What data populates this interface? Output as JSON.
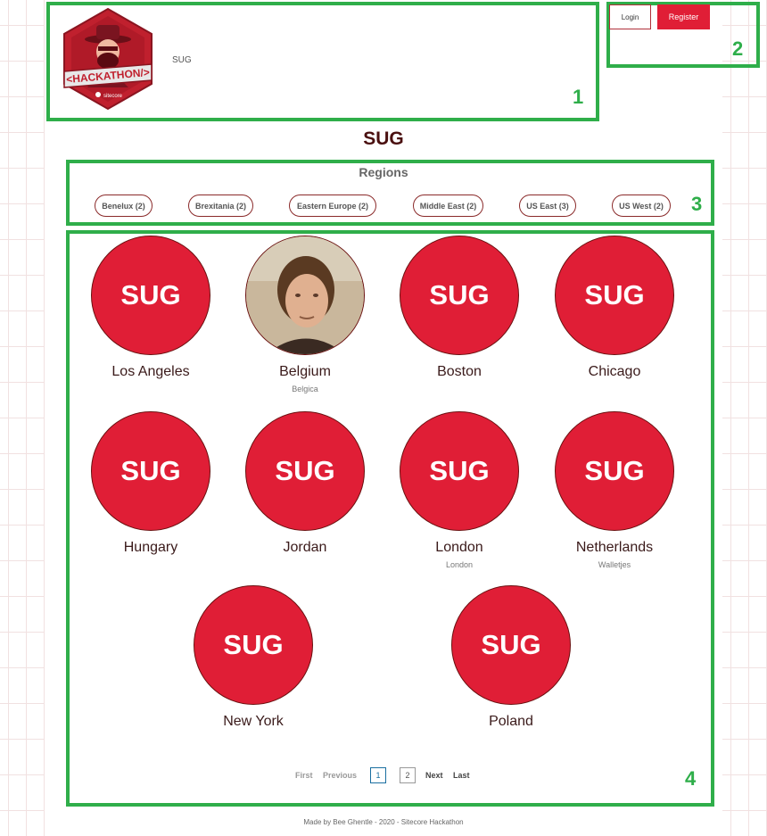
{
  "header": {
    "site_name": "SUG",
    "logo_text": "<HACKATHON/>",
    "logo_sub": "sitecore"
  },
  "auth": {
    "login_label": "Login",
    "register_label": "Register"
  },
  "page": {
    "title": "SUG"
  },
  "regions": {
    "heading": "Regions",
    "items": [
      {
        "label": "Benelux (2)"
      },
      {
        "label": "Brexitania (2)"
      },
      {
        "label": "Eastern Europe (2)"
      },
      {
        "label": "Middle East (2)"
      },
      {
        "label": "US East (3)"
      },
      {
        "label": "US West (2)"
      }
    ]
  },
  "groups": [
    {
      "name": "Los Angeles",
      "sub": "",
      "badge": "SUG"
    },
    {
      "name": "Belgium",
      "sub": "Belgica",
      "badge": ""
    },
    {
      "name": "Boston",
      "sub": "",
      "badge": "SUG"
    },
    {
      "name": "Chicago",
      "sub": "",
      "badge": "SUG"
    },
    {
      "name": "Hungary",
      "sub": "",
      "badge": "SUG"
    },
    {
      "name": "Jordan",
      "sub": "",
      "badge": "SUG"
    },
    {
      "name": "London",
      "sub": "London",
      "badge": "SUG"
    },
    {
      "name": "Netherlands",
      "sub": "Walletjes",
      "badge": "SUG"
    },
    {
      "name": "New York",
      "sub": "",
      "badge": "SUG"
    },
    {
      "name": "Poland",
      "sub": "",
      "badge": "SUG"
    }
  ],
  "pagination": {
    "first": "First",
    "previous": "Previous",
    "pages": [
      "1",
      "2"
    ],
    "current": 1,
    "next": "Next",
    "last": "Last"
  },
  "footer": {
    "text": "Made by Bee Ghentle  - 2020 - Sitecore Hackathon"
  },
  "annotations": [
    "1",
    "2",
    "3",
    "4"
  ],
  "colors": {
    "brand_red": "#e01e36",
    "annotation_green": "#2fae4a"
  }
}
